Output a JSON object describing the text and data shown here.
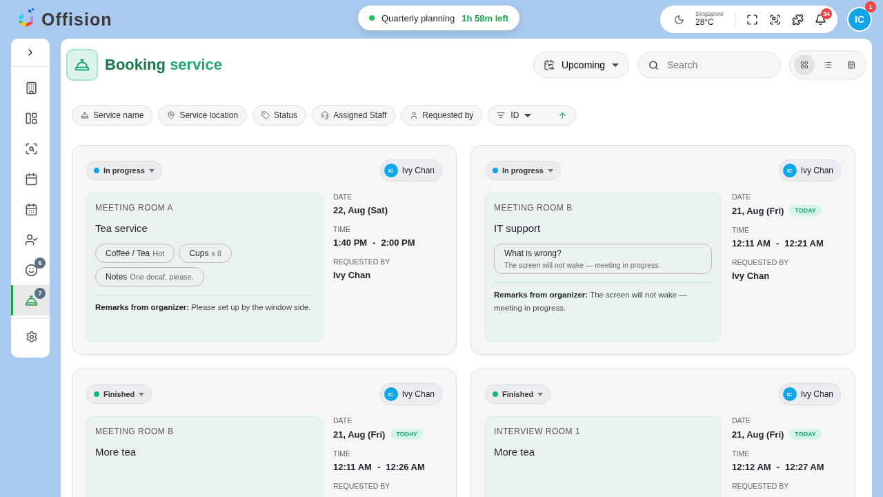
{
  "brand": "Offision",
  "meeting_banner": {
    "title": "Quarterly planning",
    "time_left": "1h 58m left"
  },
  "weather": {
    "city": "Singapore",
    "temperature": "28°C"
  },
  "notifications": {
    "count": "34"
  },
  "user": {
    "initials": "IC",
    "badge": "1"
  },
  "sidebar": {
    "items": [
      {
        "selected": false
      },
      {
        "selected": false
      },
      {
        "selected": false
      },
      {
        "selected": false
      },
      {
        "selected": false
      },
      {
        "selected": false
      },
      {
        "selected": false,
        "badge": "6"
      },
      {
        "selected": true,
        "badge": "7"
      }
    ]
  },
  "page": {
    "title_dark": "Booking",
    "title_light": "service"
  },
  "period_filter": {
    "label": "Upcoming"
  },
  "search": {
    "placeholder": "Search"
  },
  "views": [
    {
      "kind": "grid",
      "selected": true
    },
    {
      "kind": "list",
      "selected": false
    },
    {
      "kind": "calendar",
      "selected": false
    }
  ],
  "filters": [
    {
      "label": "Service name"
    },
    {
      "label": "Service location"
    },
    {
      "label": "Status"
    },
    {
      "label": "Assigned Staff"
    },
    {
      "label": "Requested by"
    }
  ],
  "sort": {
    "label": "ID",
    "ascending": true
  },
  "bookings": [
    {
      "status": "In progress",
      "color": "#0ea5e9",
      "assignee_initials": "IC",
      "assignee": "Ivy Chan",
      "location": "MEETING ROOM A",
      "service": "Tea service",
      "chips": [
        {
          "label": "Coffee / Tea",
          "note": "Hot"
        },
        {
          "label": "Cups",
          "note": "x 8"
        },
        {
          "label": "Notes",
          "note": "One decaf, please."
        }
      ],
      "remarks": "**Remarks from organizer:** Please set up by the window side.",
      "date_label": "DATE",
      "date": "22, Aug (Sat)",
      "today": false,
      "time_label": "TIME",
      "time_start": "1:40 PM",
      "time_sep": "-",
      "time_end": "2:00 PM",
      "requested_label": "REQUESTED BY",
      "requested_by": "Ivy Chan"
    },
    {
      "status": "In progress",
      "color": "#0ea5e9",
      "assignee_initials": "IC",
      "assignee": "Ivy Chan",
      "location": "MEETING ROOM B",
      "service": "IT support",
      "question": {
        "label": "What is wrong?",
        "answer": "The screen will not wake — meeting in progress."
      },
      "remarks": "**Remarks from organizer:** The screen will not wake — meeting in progress.",
      "date_label": "DATE",
      "date": "21, Aug (Fri)",
      "today": true,
      "today_label": "TODAY",
      "time_label": "TIME",
      "time_start": "12:11 AM",
      "time_sep": "-",
      "time_end": "12:21 AM",
      "requested_label": "REQUESTED BY",
      "requested_by": "Ivy Chan"
    },
    {
      "status": "Finished",
      "color": "#10b981",
      "assignee_initials": "IC",
      "assignee": "Ivy Chan",
      "location": "MEETING ROOM B",
      "service": "More tea",
      "date_label": "DATE",
      "date": "21, Aug (Fri)",
      "today": true,
      "today_label": "TODAY",
      "time_label": "TIME",
      "time_start": "12:11 AM",
      "time_sep": "-",
      "time_end": "12:26 AM",
      "requested_label": "REQUESTED BY"
    },
    {
      "status": "Finished",
      "color": "#10b981",
      "assignee_initials": "IC",
      "assignee": "Ivy Chan",
      "location": "INTERVIEW ROOM 1",
      "service": "More tea",
      "date_label": "DATE",
      "date": "21, Aug (Fri)",
      "today": true,
      "today_label": "TODAY",
      "time_label": "TIME",
      "time_start": "12:12 AM",
      "time_sep": "-",
      "time_end": "12:27 AM",
      "requested_label": "REQUESTED BY"
    }
  ]
}
